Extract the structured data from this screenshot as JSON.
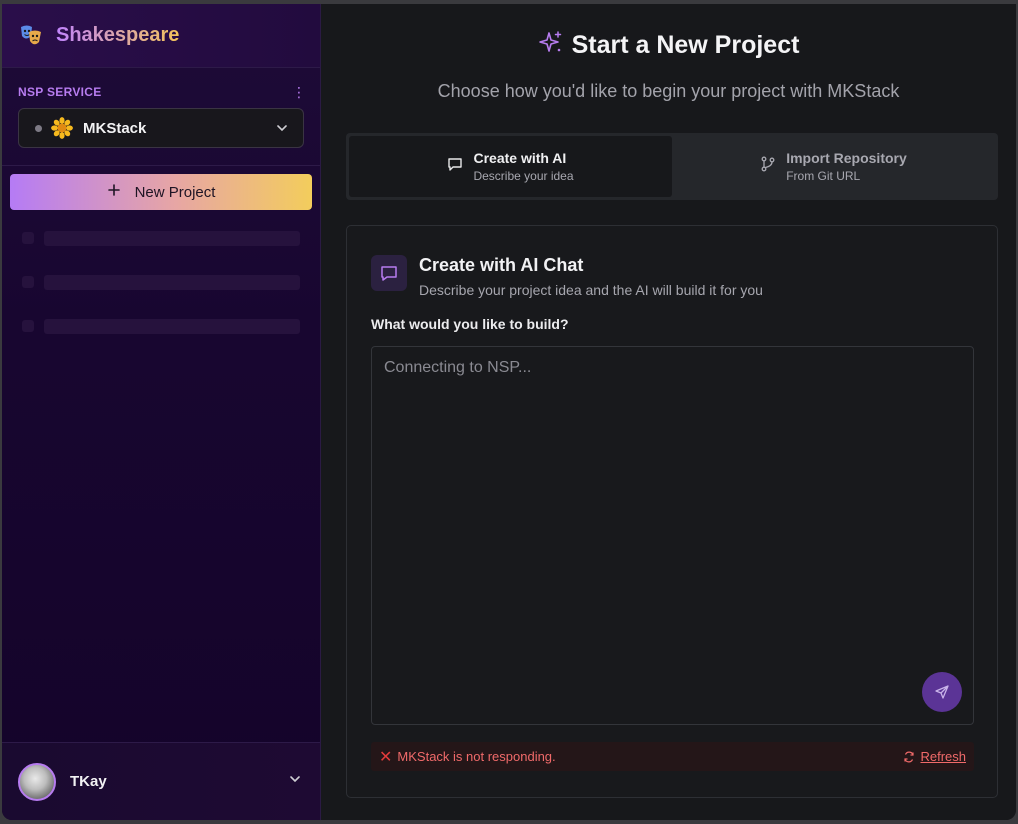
{
  "app": {
    "name": "Shakespeare"
  },
  "sidebar": {
    "section_label": "NSP SERVICE",
    "service": {
      "name": "MKStack",
      "icon": "sunflower-icon",
      "status_color": "#7d7a85"
    },
    "new_project_label": "New Project",
    "user": {
      "name": "TKay"
    }
  },
  "main": {
    "title": "Start a New Project",
    "subtitle": "Choose how you'd like to begin your project with MKStack",
    "tabs": [
      {
        "label": "Create with AI",
        "sub": "Describe your idea",
        "icon": "chat-icon",
        "active": true
      },
      {
        "label": "Import Repository",
        "sub": "From Git URL",
        "icon": "git-branch-icon",
        "active": false
      }
    ],
    "card": {
      "title": "Create with AI Chat",
      "description": "Describe your project idea and the AI will build it for you",
      "field_label": "What would you like to build?",
      "placeholder": "Connecting to NSP..."
    },
    "error": {
      "message": "MKStack is not responding.",
      "action_label": "Refresh"
    }
  },
  "colors": {
    "accent": "#b77cf0",
    "gradient_start": "#b57bf5",
    "gradient_end": "#f3cd5c",
    "error": "#f06a6a",
    "send_button": "#5b3496"
  }
}
